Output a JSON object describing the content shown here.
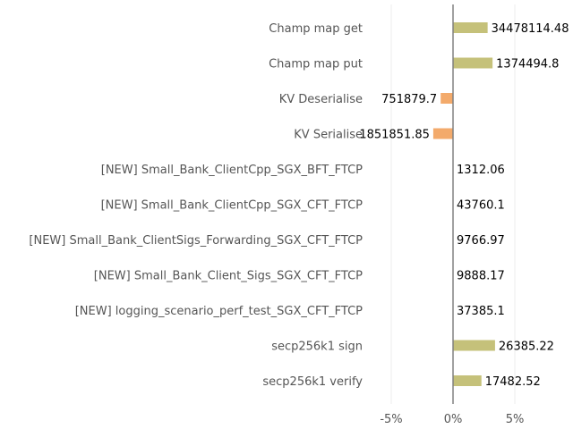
{
  "chart_data": {
    "type": "bar",
    "orientation": "horizontal",
    "categories": [
      "Champ map get",
      "Champ map put",
      "KV Deserialise",
      "KV Serialise",
      "[NEW] Small_Bank_ClientCpp_SGX_BFT_FTCP",
      "[NEW] Small_Bank_ClientCpp_SGX_CFT_FTCP",
      "[NEW] Small_Bank_ClientSigs_Forwarding_SGX_CFT_FTCP",
      "[NEW] Small_Bank_Client_Sigs_SGX_CFT_FTCP",
      "[NEW] logging_scenario_perf_test_SGX_CFT_FTCP",
      "secp256k1 sign",
      "secp256k1 verify"
    ],
    "values": [
      2.8,
      3.2,
      -1.0,
      -1.6,
      0,
      0,
      0,
      0,
      0,
      3.4,
      2.3
    ],
    "value_labels": [
      "34478114.48",
      "1374494.8",
      "751879.7",
      "1851851.85",
      "1312.06",
      "43760.1",
      "9766.97",
      "9888.17",
      "37385.1",
      "26385.22",
      "17482.52"
    ],
    "xticks": [
      "-5%",
      "0%",
      "5%"
    ],
    "xtick_values": [
      -5,
      0,
      5
    ],
    "xlim": [
      -7.2,
      9.7
    ],
    "grid": true,
    "colors": {
      "positive": "#c5c17a",
      "negative": "#f3aa6b",
      "zero_line": "#808080",
      "grid": "#eeeeee"
    }
  }
}
